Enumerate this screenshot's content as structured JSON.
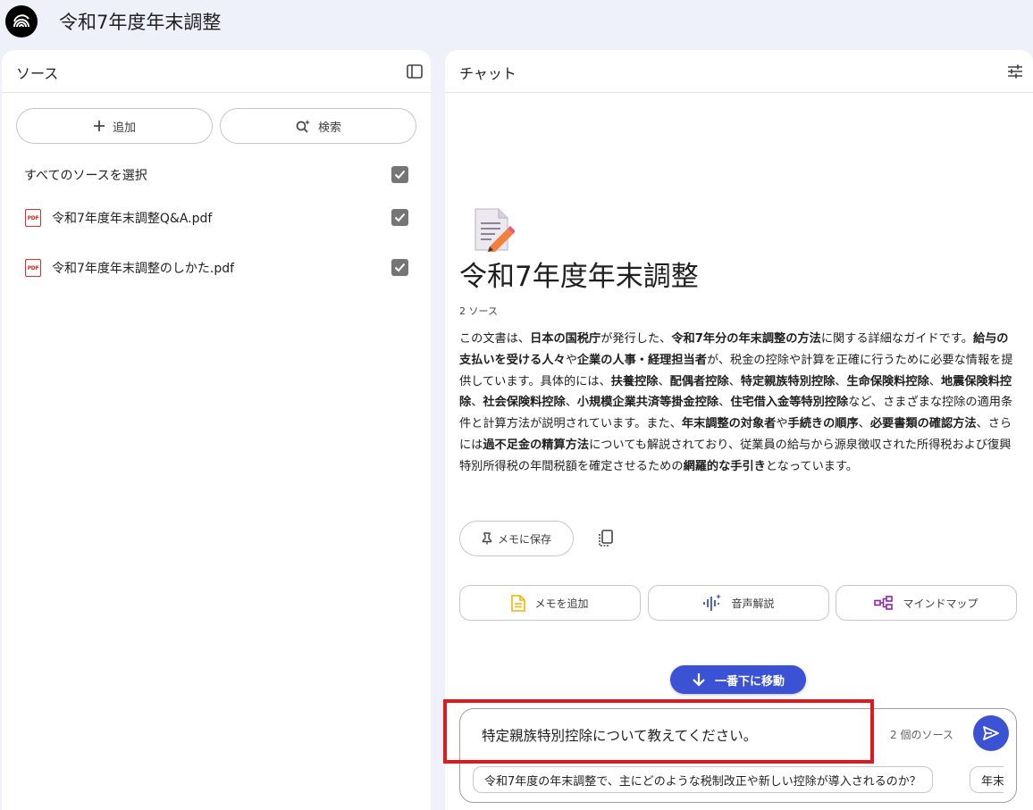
{
  "app": {
    "title": "令和7年度年末調整",
    "logo_icon": "notebook-logo-icon"
  },
  "sources_panel": {
    "title": "ソース",
    "collapse_icon": "panel-toggle-icon",
    "add_label": "追加",
    "search_label": "検索",
    "select_all_label": "すべてのソースを選択",
    "select_all_checked": true,
    "items": [
      {
        "name": "令和7年度年末調整Q&A.pdf",
        "icon": "pdf-icon",
        "checked": true
      },
      {
        "name": "令和7年度年末調整のしかた.pdf",
        "icon": "pdf-icon",
        "checked": true
      }
    ]
  },
  "chat_panel": {
    "title": "チャット",
    "settings_icon": "tune-icon",
    "notebook_title": "令和7年度年末調整",
    "source_count": "2 ソース",
    "summary_segments": [
      {
        "t": "この文書は、",
        "b": false
      },
      {
        "t": "日本の国税庁",
        "b": true
      },
      {
        "t": "が発行した、",
        "b": false
      },
      {
        "t": "令和7年分の年末調整の方法",
        "b": true
      },
      {
        "t": "に関する詳細なガイドです。",
        "b": false
      },
      {
        "t": "給与の支払いを受ける人々",
        "b": true
      },
      {
        "t": "や",
        "b": false
      },
      {
        "t": "企業の人事・経理担当者",
        "b": true
      },
      {
        "t": "が、税金の控除や計算を正確に行うために必要な情報を提供しています。具体的には、",
        "b": false
      },
      {
        "t": "扶養控除",
        "b": true
      },
      {
        "t": "、",
        "b": false
      },
      {
        "t": "配偶者控除",
        "b": true
      },
      {
        "t": "、",
        "b": false
      },
      {
        "t": "特定親族特別控除",
        "b": true
      },
      {
        "t": "、",
        "b": false
      },
      {
        "t": "生命保険料控除",
        "b": true
      },
      {
        "t": "、",
        "b": false
      },
      {
        "t": "地震保険料控除",
        "b": true
      },
      {
        "t": "、",
        "b": false
      },
      {
        "t": "社会保険料控除",
        "b": true
      },
      {
        "t": "、",
        "b": false
      },
      {
        "t": "小規模企業共済等掛金控除",
        "b": true
      },
      {
        "t": "、",
        "b": false
      },
      {
        "t": "住宅借入金等特別控除",
        "b": true
      },
      {
        "t": "など、さまざまな控除の適用条件と計算方法が説明されています。また、",
        "b": false
      },
      {
        "t": "年末調整の対象者",
        "b": true
      },
      {
        "t": "や",
        "b": false
      },
      {
        "t": "手続きの順序",
        "b": true
      },
      {
        "t": "、",
        "b": false
      },
      {
        "t": "必要書類の確認方法",
        "b": true
      },
      {
        "t": "、さらには",
        "b": false
      },
      {
        "t": "過不足金の精算方法",
        "b": true
      },
      {
        "t": "についても解説されており、従業員の給与から源泉徴収された所得税および復興特別所得税の年間税額を確定させるための",
        "b": false
      },
      {
        "t": "網羅的な手引き",
        "b": true
      },
      {
        "t": "となっています。",
        "b": false
      }
    ],
    "save_memo_label": "メモに保存",
    "copy_icon": "copy-icon",
    "actions": [
      {
        "label": "メモを追加",
        "icon": "note-add-icon",
        "color": "#f4b400"
      },
      {
        "label": "音声解説",
        "icon": "audio-overview-icon",
        "color": "#3b52d4"
      },
      {
        "label": "マインドマップ",
        "icon": "mind-map-icon",
        "color": "#8e24aa"
      }
    ],
    "scroll_down_label": "一番下に移動",
    "query_text": "特定親族特別控除について教えてください。",
    "composer_source_count": "2 個のソース",
    "suggestions": [
      "令和7年度の年末調整で、主にどのような税制改正や新しい控除が導入されるのか？",
      "年末"
    ]
  },
  "colors": {
    "accent": "#3b52d4",
    "highlight": "#e0191f",
    "background": "#eef0fa"
  }
}
